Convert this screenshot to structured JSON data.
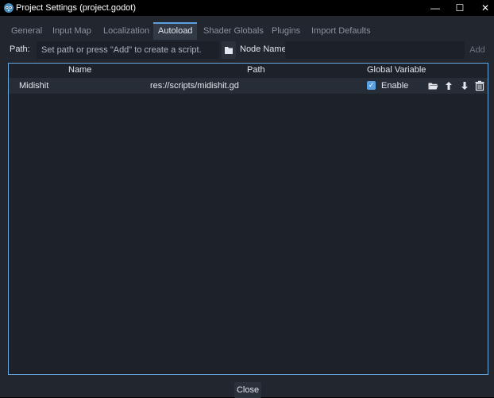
{
  "window": {
    "title": "Project Settings (project.godot)",
    "controls": {
      "minimize": "—",
      "maximize": "☐",
      "close": "✕"
    }
  },
  "tabs": [
    {
      "label": "General",
      "active": false
    },
    {
      "label": "Input Map",
      "active": false
    },
    {
      "label": "Localization",
      "active": false
    },
    {
      "label": "Autoload",
      "active": true
    },
    {
      "label": "Shader Globals",
      "active": false
    },
    {
      "label": "Plugins",
      "active": false
    },
    {
      "label": "Import Defaults",
      "active": false
    }
  ],
  "pathbar": {
    "path_label": "Path:",
    "path_placeholder": "Set path or press \"Add\" to create a script.",
    "path_value": "",
    "folder_icon": "folder-icon",
    "node_label": "Node Name:",
    "node_value": "",
    "add_label": "Add"
  },
  "table": {
    "headers": {
      "name": "Name",
      "path": "Path",
      "global": "Global Variable"
    },
    "rows": [
      {
        "name": "Midishit",
        "path": "res://scripts/midishit.gd",
        "enabled": true,
        "enable_label": "Enable",
        "icons": [
          "folder-open-icon",
          "arrow-up-icon",
          "arrow-down-icon",
          "trash-icon"
        ]
      }
    ]
  },
  "footer": {
    "close_label": "Close"
  },
  "colors": {
    "accent": "#5a9fdf",
    "panel": "#21262f",
    "list_bg": "#1d222a",
    "row_bg": "#272d37",
    "titlebar": "#000000"
  }
}
